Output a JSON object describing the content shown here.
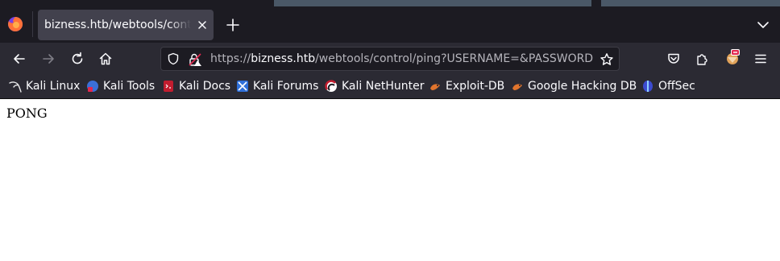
{
  "tab": {
    "title": "bizness.htb/webtools/control/ping?USERNAME=&PASSWORD=&requirePasswordChange=Y"
  },
  "urlbar": {
    "scheme": "https://",
    "host": "bizness.htb",
    "path": "/webtools/control/ping?USERNAME=&PASSWORD=&requirePasswordChange=Y"
  },
  "bookmarks": [
    {
      "label": "Kali Linux",
      "icon": "kali-dragon-icon"
    },
    {
      "label": "Kali Tools",
      "icon": "kali-tools-icon"
    },
    {
      "label": "Kali Docs",
      "icon": "kali-docs-icon"
    },
    {
      "label": "Kali Forums",
      "icon": "kali-forums-icon"
    },
    {
      "label": "Kali NetHunter",
      "icon": "nethunter-icon"
    },
    {
      "label": "Exploit-DB",
      "icon": "exploit-db-icon"
    },
    {
      "label": "Google Hacking DB",
      "icon": "ghdb-icon"
    },
    {
      "label": "OffSec",
      "icon": "offsec-icon"
    }
  ],
  "page": {
    "body_text": "PONG"
  },
  "colors": {
    "chrome_dark": "#1c1b22",
    "toolbar": "#2b2a33",
    "tab_active": "#42414d",
    "text": "#fbfbfe"
  }
}
